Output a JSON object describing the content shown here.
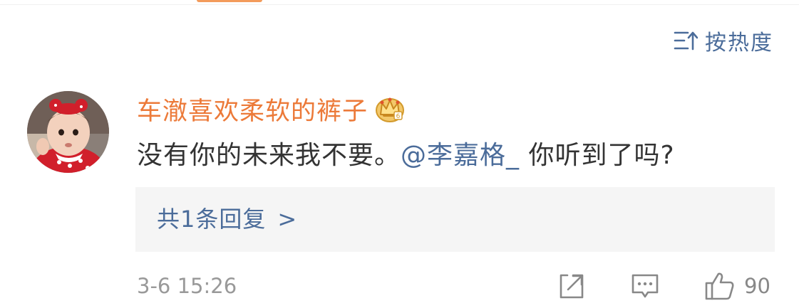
{
  "sort": {
    "label": "按热度",
    "icon": "sort-icon"
  },
  "comment": {
    "user": {
      "name": "车澈喜欢柔软的裤子",
      "avatar": "avatar",
      "badge_icon": "crown-badge-icon"
    },
    "text_before": "没有你的未来我不要。",
    "mention": "@李嘉格_",
    "text_after": " 你听到了吗?",
    "replies_label": "共1条回复",
    "replies_chevron": ">",
    "timestamp": "3-6 15:26",
    "actions": {
      "share_icon": "share-icon",
      "comment_icon": "comment-icon",
      "like_icon": "thumbs-up-icon",
      "like_count": "90"
    }
  },
  "colors": {
    "username": "#ec7a39",
    "link": "#4b6c9a",
    "text": "#333333",
    "meta": "#999999",
    "reply_bg": "#f5f5f5"
  }
}
